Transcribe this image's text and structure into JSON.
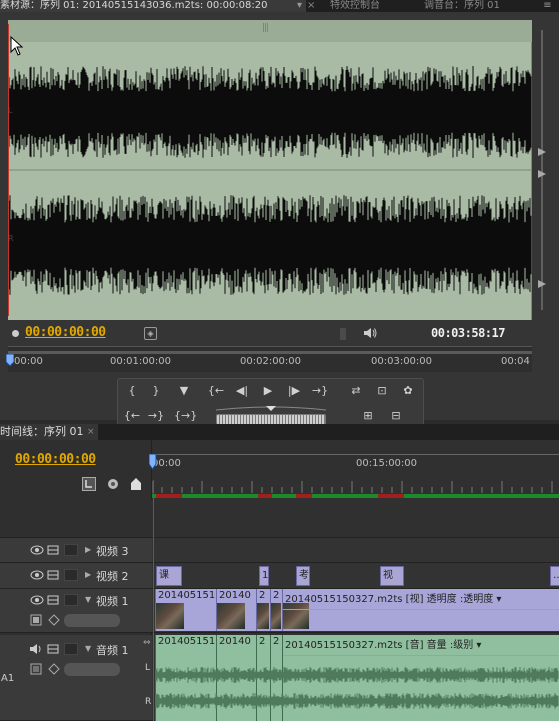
{
  "source_panel": {
    "tab_source": "素材源：序列 01: 20140515143036.m2ts: 00:00:08:20",
    "tab_effect_controls": "特效控制台",
    "tab_mixer": "调音台：序列 01",
    "channel_left": "L",
    "channel_right": "R",
    "current_timecode": "00:00:00:00",
    "duration_timecode": "00:03:58:17",
    "ruler_labels": [
      "00:00",
      "00:01:00:00",
      "00:02:00:00",
      "00:03:00:00",
      "00:04"
    ]
  },
  "transport": {
    "row1": [
      "{",
      "}",
      "▼",
      "{←",
      "◀|",
      "▶",
      "|▶",
      "→}",
      "⇄",
      "⊡",
      "✿"
    ],
    "row2": [
      "{←",
      "→}",
      "{→}",
      "⊞",
      "⊟"
    ]
  },
  "timeline": {
    "tab_label": "时间线：序列 01",
    "current_timecode": "00:00:00:00",
    "ruler_labels": [
      "00:00",
      "00:15:00:00"
    ],
    "tracks": {
      "video3": "视频 3",
      "video2": "视频 2",
      "video1": "视频 1",
      "audio1": "音频 1",
      "audio_channel_l": "L",
      "audio_channel_r": "R",
      "track_a1": "A1"
    },
    "title_clips": [
      "课",
      "1",
      "考",
      "视",
      "…"
    ],
    "video_clips": [
      {
        "label": "20140515151"
      },
      {
        "label": "20140"
      },
      {
        "label": "2"
      },
      {
        "label": "2"
      },
      {
        "label": "20140515150327.m2ts  [视]  透明度 :透明度 ▾"
      }
    ],
    "audio_clips": [
      {
        "label": "20140515151"
      },
      {
        "label": "20140"
      },
      {
        "label": "2"
      },
      {
        "label": "2"
      },
      {
        "label": "20140515150327.m2ts  [音]  音量 :级别 ▾"
      }
    ]
  },
  "colors": {
    "accent_timecode": "#e0a800",
    "waveform_bg": "#a9bba5",
    "playhead": "#c03030",
    "video_clip": "#a8a6d8",
    "audio_clip": "#8fbf9e"
  }
}
